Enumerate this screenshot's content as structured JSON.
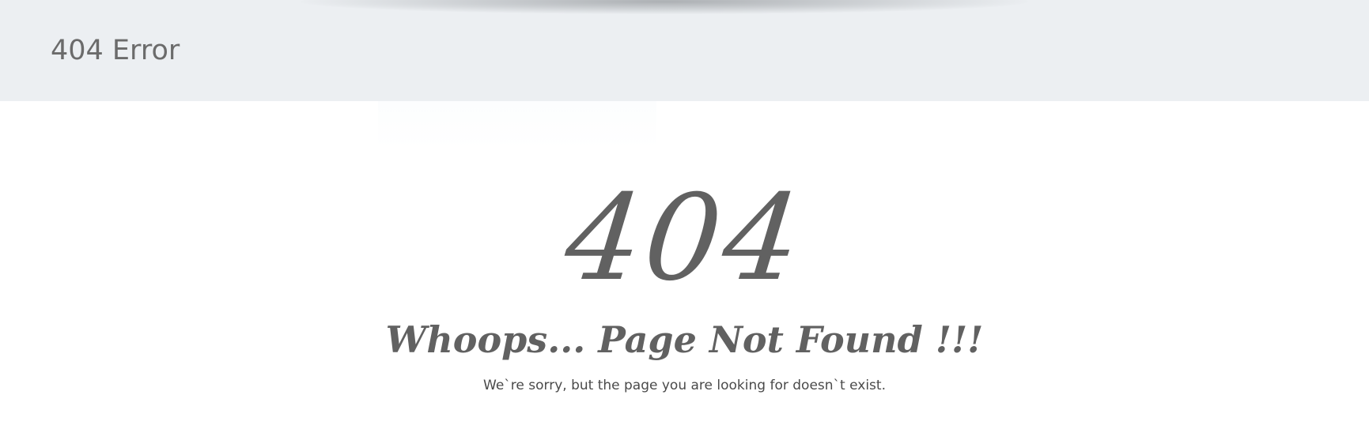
{
  "header": {
    "title": "404 Error"
  },
  "error": {
    "code": "404",
    "heading": "Whoops... Page Not Found !!!",
    "message": "We`re sorry, but the page you are looking for doesn`t exist."
  },
  "colors": {
    "header_background": "#eceff2",
    "page_background": "#ffffff",
    "text_primary": "#616161",
    "title_text": "#6b6b6b",
    "message_text": "#4a4a4a"
  }
}
